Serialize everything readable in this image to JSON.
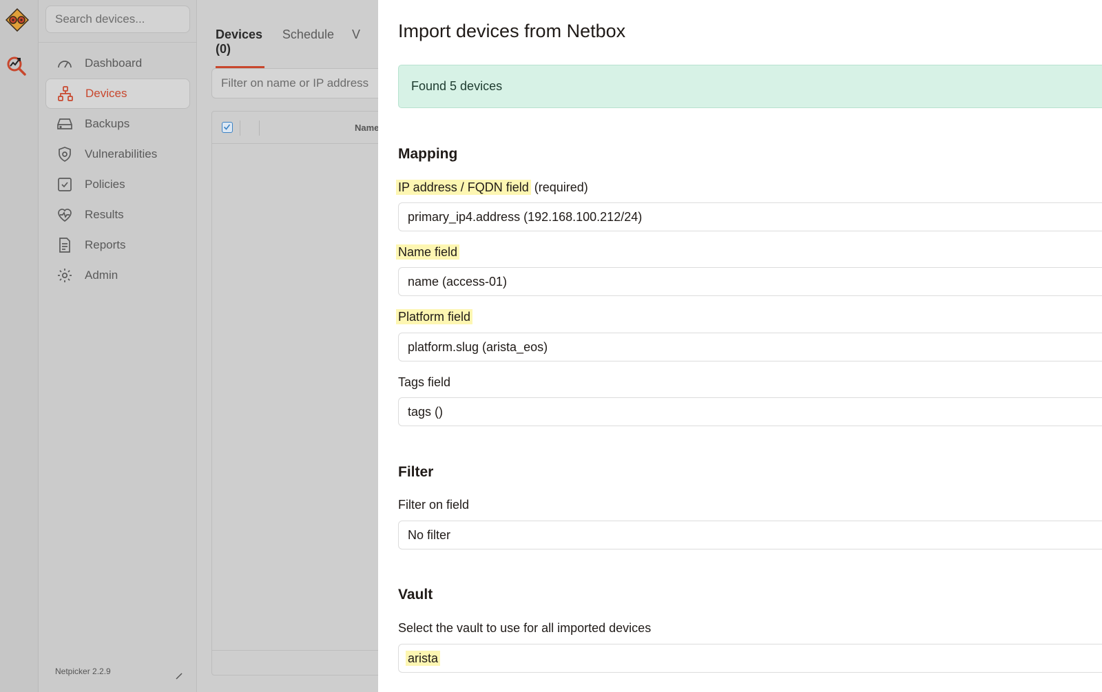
{
  "sidebar": {
    "search_placeholder": "Search devices...",
    "items": [
      {
        "label": "Dashboard",
        "icon": "gauge-icon"
      },
      {
        "label": "Devices",
        "icon": "network-icon"
      },
      {
        "label": "Backups",
        "icon": "hard-drive-icon"
      },
      {
        "label": "Vulnerabilities",
        "icon": "shield-icon"
      },
      {
        "label": "Policies",
        "icon": "checkbox-icon"
      },
      {
        "label": "Results",
        "icon": "heart-pulse-icon"
      },
      {
        "label": "Reports",
        "icon": "document-icon"
      },
      {
        "label": "Admin",
        "icon": "gear-icon"
      }
    ],
    "version": "Netpicker 2.2.9"
  },
  "main": {
    "tabs": [
      {
        "label": "Devices (0)"
      },
      {
        "label": "Schedule"
      },
      {
        "label": "V"
      }
    ],
    "filter_placeholder": "Filter on name or IP address",
    "table": {
      "name_header": "Name"
    }
  },
  "panel": {
    "title": "Import devices from Netbox",
    "alert": "Found 5 devices",
    "mapping": {
      "heading": "Mapping",
      "ip_label": "IP address / FQDN field",
      "ip_required": "(required)",
      "ip_value": "primary_ip4.address (192.168.100.212/24)",
      "name_label": "Name field",
      "name_value": "name (access-01)",
      "platform_label": "Platform field",
      "platform_value": "platform.slug (arista_eos)",
      "tags_label": "Tags field",
      "tags_value": "tags ()"
    },
    "filter": {
      "heading": "Filter",
      "label": "Filter on field",
      "value": "No filter"
    },
    "vault": {
      "heading": "Vault",
      "label": "Select the vault to use for all imported devices",
      "value": "arista"
    }
  },
  "colors": {
    "accent": "#c8472d",
    "alert_bg": "#d7f2e6",
    "highlight": "#fdf6b2"
  }
}
